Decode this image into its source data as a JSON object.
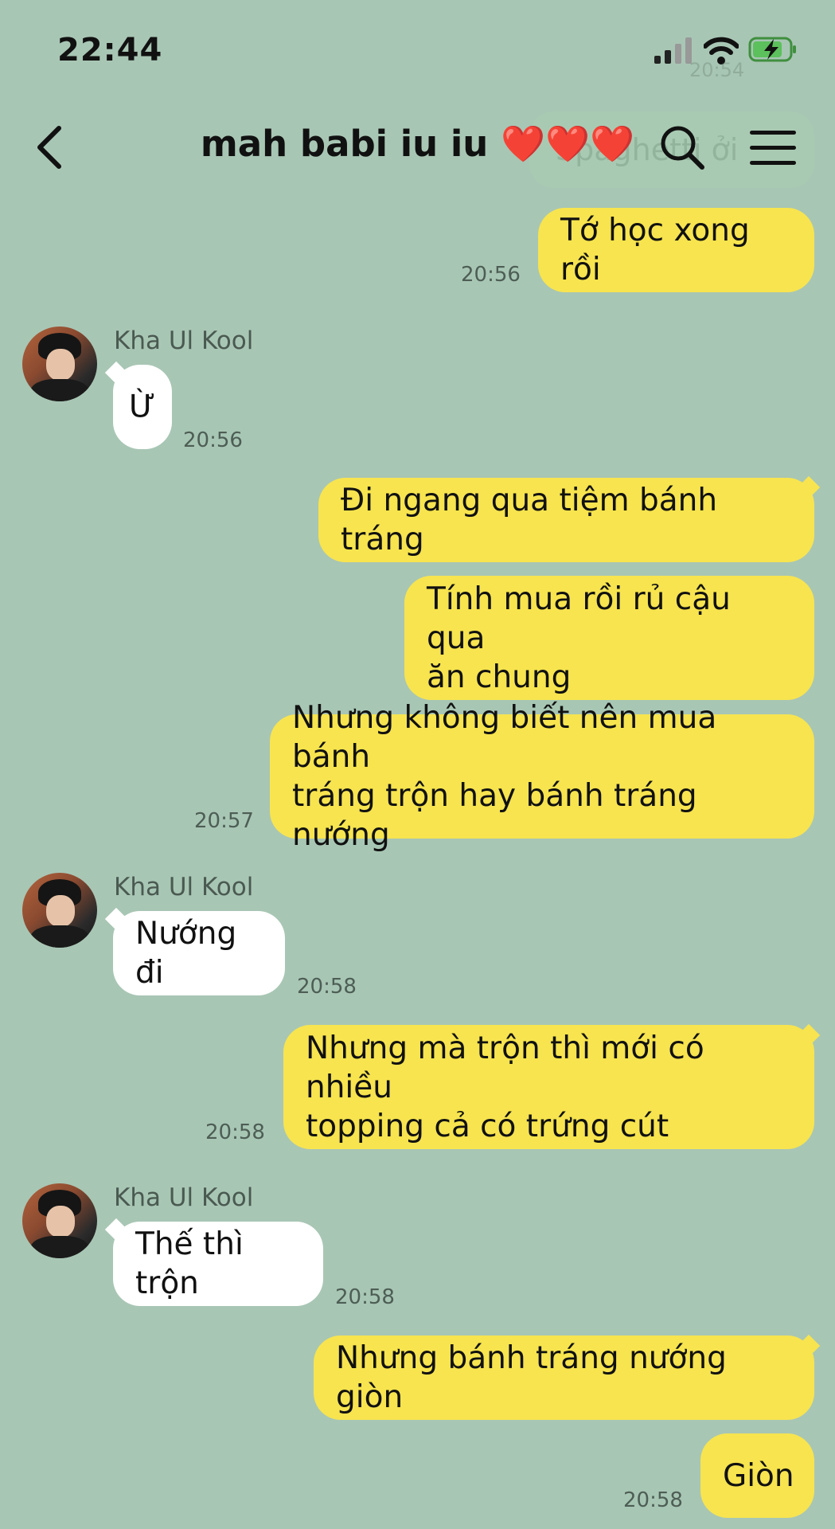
{
  "status": {
    "time": "22:44"
  },
  "ghost": {
    "time": "20:54",
    "text": "Spaghetti ởi"
  },
  "header": {
    "title": "mah babi iu iu ❤️❤️❤️"
  },
  "contact": {
    "name": "Kha Ul Kool"
  },
  "messages": [
    {
      "dir": "out",
      "text": "Tớ học xong rồi",
      "time": "20:56"
    },
    {
      "dir": "in",
      "text": "Ừ",
      "time": "20:56"
    },
    {
      "dir": "out",
      "text": "Đi ngang qua tiệm bánh tráng",
      "time": ""
    },
    {
      "dir": "out",
      "text": "Tính mua rồi rủ cậu qua\năn chung",
      "time": ""
    },
    {
      "dir": "out",
      "text": "Nhưng không biết nên mua bánh\ntráng trộn hay bánh tráng nướng",
      "time": "20:57"
    },
    {
      "dir": "in",
      "text": "Nướng đi",
      "time": "20:58"
    },
    {
      "dir": "out",
      "text": "Nhưng mà trộn thì mới có nhiều\ntopping cả có trứng cút",
      "time": "20:58"
    },
    {
      "dir": "in",
      "text": "Thế thì trộn",
      "time": "20:58"
    },
    {
      "dir": "out",
      "text": "Nhưng bánh tráng nướng giòn",
      "time": ""
    },
    {
      "dir": "out",
      "text": "Giòn",
      "time": "20:58"
    }
  ],
  "colors": {
    "background": "#a8c6b4",
    "outgoing": "#f7e44f",
    "incoming": "#ffffff"
  }
}
